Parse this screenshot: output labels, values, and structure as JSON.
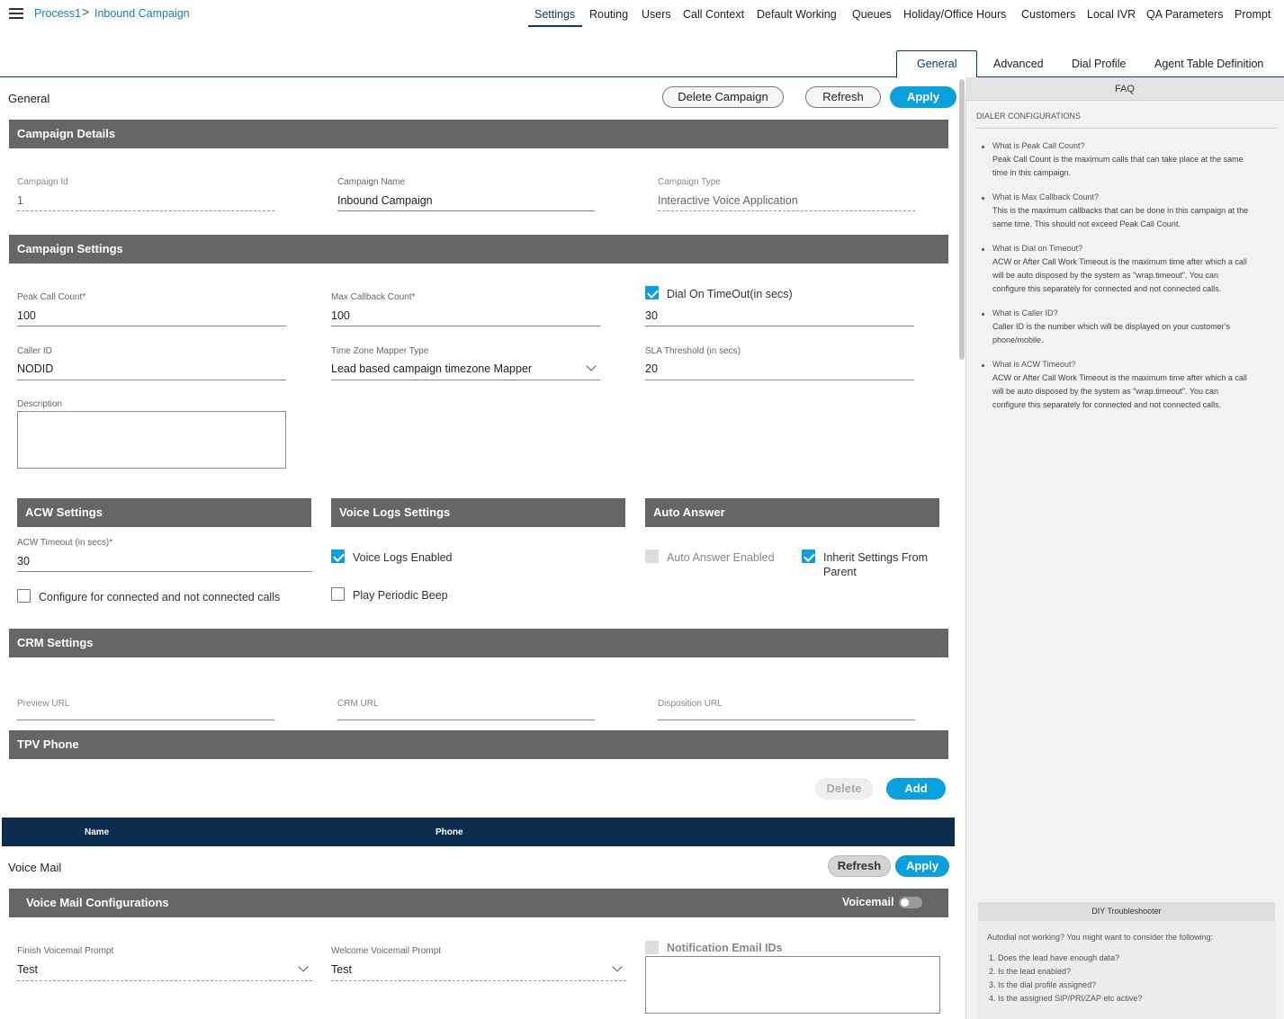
{
  "breadcrumb": {
    "process": "Process1",
    "separator": ">",
    "campaign": "Inbound Campaign"
  },
  "topnav": [
    "Settings",
    "Routing",
    "Users",
    "Call Context",
    "Default Working",
    "Queues",
    "Holiday/Office Hours",
    "Customers",
    "Local IVR",
    "QA Parameters",
    "Prompt"
  ],
  "subtabs": [
    "General",
    "Advanced",
    "Dial Profile",
    "Agent Table Definition"
  ],
  "general": {
    "title": "General",
    "delete_label": "Delete Campaign",
    "refresh_label": "Refresh",
    "apply_label": "Apply"
  },
  "campaign_details": {
    "header": "Campaign Details",
    "id_label": "Campaign Id",
    "id_value": "1",
    "name_label": "Campaign Name",
    "name_value": "Inbound Campaign",
    "type_label": "Campaign Type",
    "type_value": "Interactive Voice Application"
  },
  "campaign_settings": {
    "header": "Campaign Settings",
    "peak_label": "Peak Call Count*",
    "peak_value": "100",
    "callback_label": "Max Callback Count*",
    "callback_value": "100",
    "dial_timeout_label": "Dial On TimeOut(in secs)",
    "dial_timeout_checked": true,
    "dial_timeout_value": "30",
    "caller_label": "Caller ID",
    "caller_value": "NODID",
    "tz_label": "Time Zone Mapper Type",
    "tz_value": "Lead based campaign timezone Mapper",
    "sla_label": "SLA Threshold (in secs)",
    "sla_value": "20",
    "desc_label": "Description",
    "desc_value": ""
  },
  "acw": {
    "header": "ACW Settings",
    "timeout_label": "ACW Timeout (in secs)*",
    "timeout_value": "30",
    "configure_label": "Configure for connected and not connected calls",
    "configure_checked": false
  },
  "voice_logs": {
    "header": "Voice Logs Settings",
    "enabled_label": "Voice Logs Enabled",
    "enabled_checked": true,
    "beep_label": "Play Periodic Beep",
    "beep_checked": false
  },
  "auto_answer": {
    "header": "Auto Answer",
    "enabled_label": "Auto Answer Enabled",
    "enabled_checked": false,
    "inherit_label_1": "Inherit Settings From",
    "inherit_label_2": "Parent",
    "inherit_checked": true
  },
  "crm": {
    "header": "CRM Settings",
    "preview_label": "Preview URL",
    "crm_label": "CRM URL",
    "disposition_label": "Disposition URL"
  },
  "tpv": {
    "header": "TPV Phone",
    "delete_label": "Delete",
    "add_label": "Add",
    "columns": [
      "Name",
      "Phone"
    ]
  },
  "voice_mail": {
    "title": "Voice Mail",
    "refresh_label": "Refresh",
    "apply_label": "Apply",
    "config_header": "Voice Mail Configurations",
    "toggle_label": "Voicemail",
    "toggle_on": false,
    "finish_label": "Finish Voicemail Prompt",
    "finish_value": "Test",
    "welcome_label": "Welcome Voicemail Prompt",
    "welcome_value": "Test",
    "notify_label": "Notification Email IDs"
  },
  "faq": {
    "title": "FAQ",
    "section": "DIALER CONFIGURATIONS",
    "items": [
      {
        "q": "What is Peak Call Count?",
        "a": [
          "Peak Call Count is the maximum calls that can take place at the same",
          "time in this campaign."
        ]
      },
      {
        "q": "What is Max Callback Count?",
        "a": [
          "This is the maximum callbacks that can be done in this campaign at the",
          "same time. This should not exceed Peak Call Count."
        ]
      },
      {
        "q": "What is Dial on Timeout?",
        "a": [
          "ACW or After Call Work Timeout is the maximum time after which a call",
          "will be auto disposed by the system as \"wrap.timeout\". You can",
          "configure this separately for connected and not connected calls."
        ]
      },
      {
        "q": "What is Caller ID?",
        "a": [
          "Caller ID is the number which will be displayed on your customer's",
          "phone/mobile."
        ]
      },
      {
        "q": "What is ACW Timeout?",
        "a": [
          "ACW or After Call Work Timeout is the maximum time after which a call",
          "will be auto disposed by the system as \"wrap.timeout\". You can",
          "configure this separately for connected and not connected calls."
        ]
      }
    ]
  },
  "diy": {
    "title": "DIY Troubleshooter",
    "intro": "Autodial not working? You might want to consider the following:",
    "items": [
      "1. Does the lead have enough data?",
      "2. Is the lead enabled?",
      "3. Is the dial profile assigned?",
      "4. Is the assigned SIP/PRI/ZAP etc active?"
    ]
  }
}
